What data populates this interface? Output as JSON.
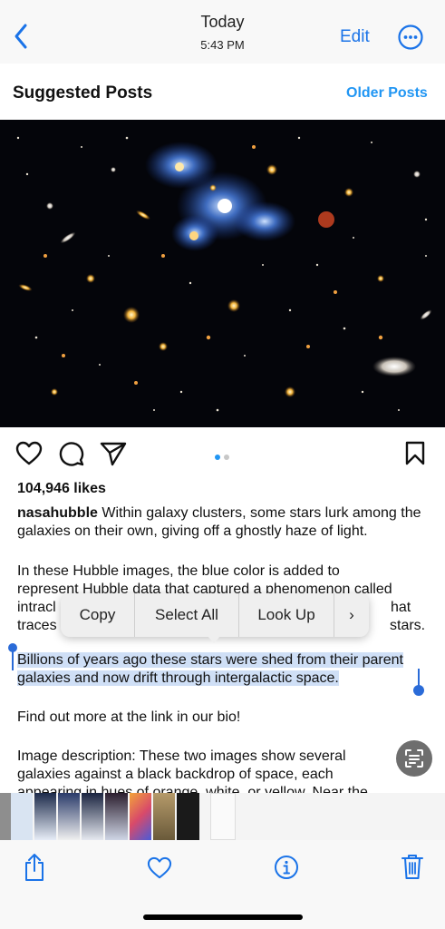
{
  "nav": {
    "title": "Today",
    "subtitle": "5:43 PM",
    "edit_label": "Edit"
  },
  "post": {
    "header": "Suggested Posts",
    "older_link": "Older Posts",
    "likes": "104,946 likes",
    "username": "nasahubble",
    "caption_1": "Within galaxy clusters, some stars lurk among the galaxies on their own, giving off a ghostly haze of light.",
    "caption_2_line1": "In these Hubble images, the blue color is added to",
    "caption_2_line2": "represent Hubble data that captured a phenomenon called",
    "caption_2_line3_start": "intracl",
    "caption_2_line3_end": "hat",
    "caption_2_line4_start": "traces",
    "caption_2_line4_end": "stars.",
    "selected_text": "Billions of years ago these stars were shed from their parent galaxies and now drift through intergalactic space.",
    "caption_4": "Find out more at the link in our bio!",
    "caption_5": "Image description: These two images show several galaxies against a black backdrop of space, each appearing in hues of orange, white, or yellow. Near the",
    "page_indicator": {
      "current": 1,
      "total": 2
    }
  },
  "context_menu": {
    "copy": "Copy",
    "select_all": "Select All",
    "look_up": "Look Up",
    "more": "›"
  },
  "icons": {
    "back": "chevron-left-icon",
    "more": "ellipsis-circle-icon",
    "like": "heart-icon",
    "comment": "comment-icon",
    "share": "paper-plane-icon",
    "save": "bookmark-icon",
    "live_text": "live-text-icon",
    "share_sheet": "share-icon",
    "favorite": "heart-outline-icon",
    "info": "info-icon",
    "delete": "trash-icon"
  },
  "colors": {
    "accent": "#1a73e8",
    "link": "#2196f3",
    "selection": "#cfdff6",
    "handle": "#2a6bd8"
  }
}
